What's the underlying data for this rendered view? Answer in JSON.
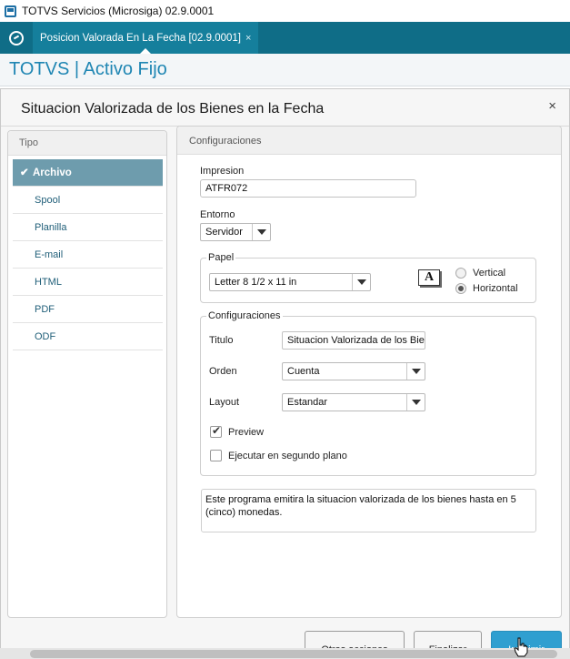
{
  "window": {
    "title": "TOTVS Servicios (Microsiga) 02.9.0001"
  },
  "tabbar": {
    "tab_label": "Posicion Valorada En La Fecha [02.9.0001]",
    "tab_close": "×"
  },
  "app": {
    "brand": "TOTVS | Activo Fijo"
  },
  "dialog": {
    "title": "Situacion Valorizada de los Bienes en la Fecha",
    "close": "×"
  },
  "left_panel": {
    "header": "Tipo",
    "check": "✔",
    "items": [
      {
        "label": "Archivo",
        "selected": true
      },
      {
        "label": "Spool"
      },
      {
        "label": "Planilla"
      },
      {
        "label": "E-mail"
      },
      {
        "label": "HTML"
      },
      {
        "label": "PDF"
      },
      {
        "label": "ODF"
      }
    ]
  },
  "right_panel": {
    "header": "Configuraciones",
    "impresion": {
      "label": "Impresion",
      "value": "ATFR072"
    },
    "entorno": {
      "label": "Entorno",
      "value": "Servidor"
    },
    "papel": {
      "legend": "Papel",
      "size": "Letter 8 1/2 x 11 in",
      "icon_letter": "A",
      "orientation": [
        {
          "label": "Vertical",
          "selected": false
        },
        {
          "label": "Horizontal",
          "selected": true
        }
      ]
    },
    "configuraciones": {
      "legend": "Configuraciones",
      "titulo": {
        "label": "Titulo",
        "value": "Situacion Valorizada de los Bien"
      },
      "orden": {
        "label": "Orden",
        "value": "Cuenta"
      },
      "layout": {
        "label": "Layout",
        "value": "Estandar"
      },
      "preview": {
        "label": "Preview",
        "checked": true,
        "tick": "✔"
      },
      "segundo_plano": {
        "label": "Ejecutar en segundo plano",
        "checked": false
      }
    },
    "description": "Este programa emitira la situacion valorizada de los bienes hasta en 5 (cinco) monedas."
  },
  "buttons": {
    "otras": "Otras acciones",
    "finalizar": "Finalizar",
    "imprimir": "Imprimir"
  },
  "colors": {
    "tabbar": "#0f6d87",
    "brand": "#1f86b3",
    "selected_item": "#6e9cad",
    "primary_button": "#2f9fd0"
  }
}
